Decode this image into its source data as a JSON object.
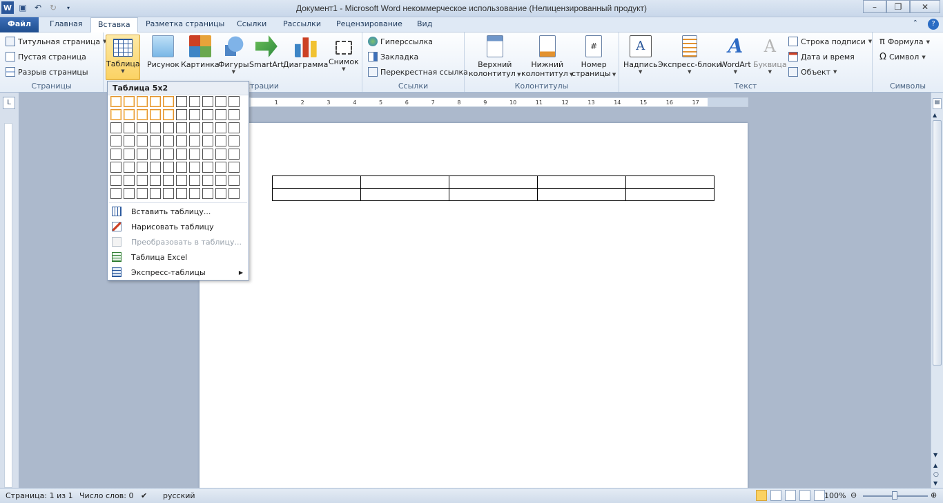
{
  "window": {
    "title": "Документ1  -  Microsoft Word некоммерческое использование (Нелицензированный продукт)",
    "app_icon": "word-icon"
  },
  "tabs": [
    {
      "label": "Файл"
    },
    {
      "label": "Главная"
    },
    {
      "label": "Вставка"
    },
    {
      "label": "Разметка страницы"
    },
    {
      "label": "Ссылки"
    },
    {
      "label": "Рассылки"
    },
    {
      "label": "Рецензирование"
    },
    {
      "label": "Вид"
    }
  ],
  "ribbon": {
    "pages": {
      "label": "Страницы",
      "items": [
        "Титульная страница",
        "Пустая страница",
        "Разрыв страницы"
      ]
    },
    "table_button": "Таблица",
    "illustrations": {
      "label": "Иллюстрации",
      "visible_label": "страции",
      "items": [
        "Рисунок",
        "Картинка",
        "Фигуры",
        "SmartArt",
        "Диаграмма",
        "Снимок"
      ]
    },
    "links": {
      "label": "Ссылки",
      "items": [
        "Гиперссылка",
        "Закладка",
        "Перекрестная ссылка"
      ]
    },
    "headers": {
      "label": "Колонтитулы",
      "items": [
        [
          "Верхний",
          "колонтитул"
        ],
        [
          "Нижний",
          "колонтитул"
        ],
        [
          "Номер",
          "страницы"
        ]
      ]
    },
    "text": {
      "label": "Текст",
      "items": [
        "Надпись",
        "Экспресс-блоки",
        "WordArt",
        "Буквица"
      ],
      "small": [
        "Строка подписи",
        "Дата и время",
        "Объект"
      ]
    },
    "symbols": {
      "label": "Символы",
      "items": [
        "Формула",
        "Символ"
      ]
    }
  },
  "dropdown": {
    "title": "Таблица 5x2",
    "grid_cols": 10,
    "grid_rows": 8,
    "selected_cols": 5,
    "selected_rows": 2,
    "items": [
      {
        "label": "Вставить таблицу...",
        "icon": "insert-table-icon",
        "disabled": false
      },
      {
        "label": "Нарисовать таблицу",
        "icon": "draw-table-icon",
        "disabled": false
      },
      {
        "label": "Преобразовать в таблицу...",
        "icon": "convert-table-icon",
        "disabled": true
      },
      {
        "label": "Таблица Excel",
        "icon": "excel-table-icon",
        "disabled": false
      },
      {
        "label": "Экспресс-таблицы",
        "icon": "quick-tables-icon",
        "disabled": false
      }
    ]
  },
  "ruler": {
    "ticks": [
      "1",
      "2",
      "3",
      "4",
      "5",
      "6",
      "7",
      "8",
      "9",
      "10",
      "11",
      "12",
      "13",
      "14",
      "15",
      "16",
      "17"
    ]
  },
  "document": {
    "table_cols": 5,
    "table_rows": 2
  },
  "status": {
    "page": "Страница: 1 из 1",
    "words": "Число слов: 0",
    "language": "русский",
    "zoom": "100%"
  },
  "colors": {
    "accent": "#2b579a",
    "highlight": "#e3922f"
  }
}
